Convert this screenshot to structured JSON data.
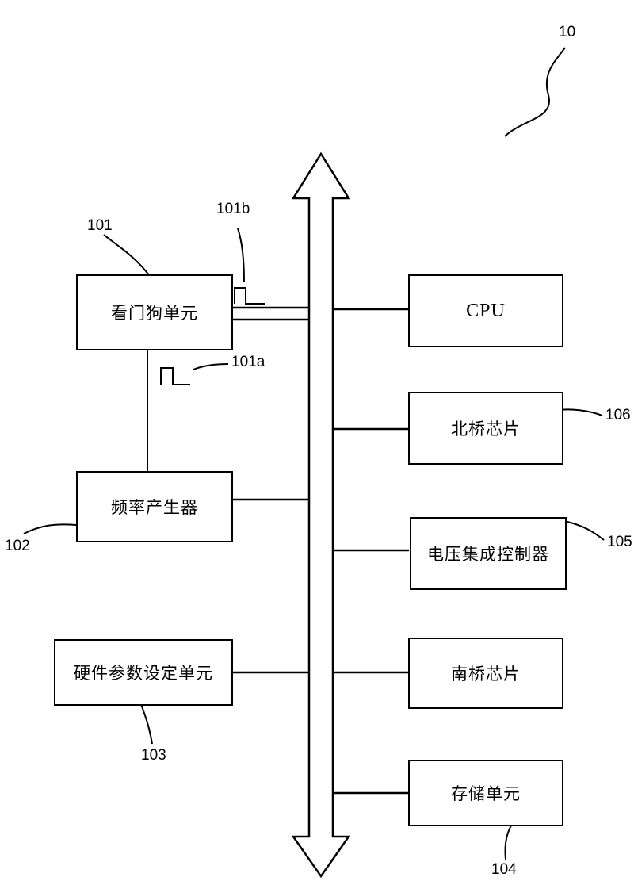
{
  "figure": {
    "ref_main": "10",
    "blocks": [
      {
        "id": "watchdog",
        "label": "看门狗单元",
        "ref": "101"
      },
      {
        "id": "freqgen",
        "label": "频率产生器",
        "ref": "102"
      },
      {
        "id": "hwparam",
        "label": "硬件参数设定单元",
        "ref": "103"
      },
      {
        "id": "cpu",
        "label": "CPU",
        "ref": ""
      },
      {
        "id": "northbridge",
        "label": "北桥芯片",
        "ref": "106"
      },
      {
        "id": "voltage",
        "label": "电压集成控制器",
        "ref": "105"
      },
      {
        "id": "southbridge",
        "label": "南桥芯片",
        "ref": ""
      },
      {
        "id": "storage",
        "label": "存储单元",
        "ref": "104"
      }
    ],
    "signal_labels": [
      {
        "id": "signal-101b",
        "text": "101b"
      },
      {
        "id": "signal-101a",
        "text": "101a"
      }
    ]
  }
}
